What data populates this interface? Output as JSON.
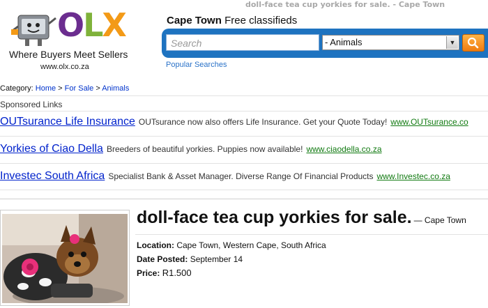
{
  "page": {
    "window_title": "doll-face tea cup yorkies for sale. - Cape Town"
  },
  "logo": {
    "text_o": "O",
    "text_l": "L",
    "text_x": "X",
    "tagline": "Where Buyers Meet Sellers",
    "url": "www.olx.co.za"
  },
  "header": {
    "city": "Cape Town",
    "heading_suffix": "Free classifieds",
    "search_placeholder": "Search",
    "category_selected": "- Animals",
    "popular_searches": "Popular Searches"
  },
  "breadcrumb": {
    "label": "Category:",
    "items": [
      "Home",
      "For Sale",
      "Animals"
    ],
    "separator": ">"
  },
  "sponsored": {
    "label": "Sponsored Links",
    "ads": [
      {
        "title": "OUTsurance Life Insurance",
        "desc": "OUTsurance now also offers Life Insurance. Get your Quote Today!",
        "url": "www.OUTsurance.co"
      },
      {
        "title": "Yorkies of Ciao Della",
        "desc": "Breeders of beautiful yorkies. Puppies now available!",
        "url": "www.ciaodella.co.za"
      },
      {
        "title": "Investec South Africa",
        "desc": "Specialist Bank & Asset Manager. Diverse Range Of Financial Products",
        "url": "www.Investec.co.za"
      }
    ]
  },
  "listing": {
    "title": "doll-face tea cup yorkies for sale.",
    "city_suffix": "— Cape Town",
    "location_label": "Location:",
    "location_value": "Cape Town, Western Cape, South Africa",
    "date_label": "Date Posted:",
    "date_value": "September 14",
    "price_label": "Price:",
    "price_value": "R1.500"
  },
  "colors": {
    "accent_blue": "#1e73c0",
    "search_orange": "#ef7c10",
    "link_blue": "#0022cc",
    "ad_url_green": "#117a11"
  }
}
